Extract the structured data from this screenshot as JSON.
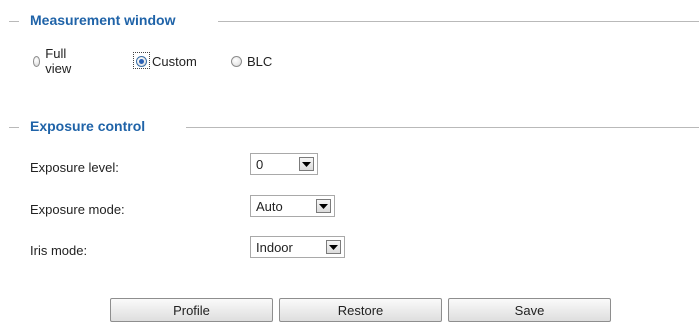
{
  "measurement": {
    "title": "Measurement window",
    "options": [
      {
        "label": "Full view",
        "checked": false
      },
      {
        "label": "Custom",
        "checked": true
      },
      {
        "label": "BLC",
        "checked": false
      }
    ]
  },
  "exposure": {
    "title": "Exposure control",
    "level_label": "Exposure level:",
    "level_value": "0",
    "mode_label": "Exposure mode:",
    "mode_value": "Auto",
    "iris_label": "Iris mode:",
    "iris_value": "Indoor"
  },
  "buttons": {
    "profile": "Profile",
    "restore": "Restore",
    "save": "Save"
  }
}
